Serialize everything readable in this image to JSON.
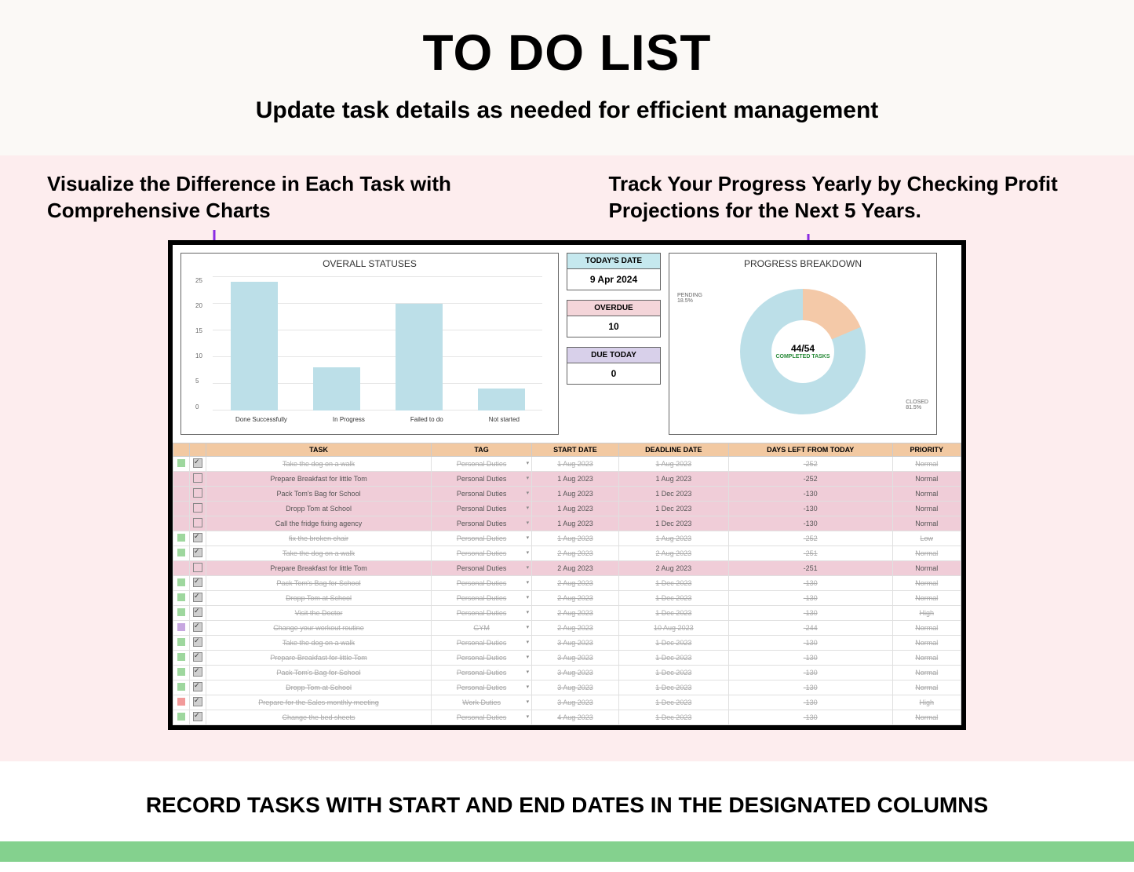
{
  "header": {
    "title": "TO DO LIST",
    "subtitle": "Update task details as needed for efficient management"
  },
  "callouts": {
    "left": "Visualize the Difference in Each Task with Comprehensive Charts",
    "right": "Track Your Progress Yearly by Checking Profit Projections for the Next 5 Years."
  },
  "stats": {
    "date_label": "TODAY'S DATE",
    "date_value": "9 Apr 2024",
    "overdue_label": "OVERDUE",
    "overdue_value": "10",
    "due_label": "DUE TODAY",
    "due_value": "0"
  },
  "chart_data": {
    "bar": {
      "type": "bar",
      "title": "OVERALL STATUSES",
      "categories": [
        "Done Successfully",
        "In Progress",
        "Failed to do",
        "Not started"
      ],
      "values": [
        24,
        8,
        20,
        4
      ],
      "ylim": [
        0,
        25
      ],
      "yticks": [
        0,
        5,
        10,
        15,
        20,
        25
      ]
    },
    "donut": {
      "type": "pie",
      "title": "PROGRESS BREAKDOWN",
      "series": [
        {
          "name": "PENDING",
          "value": 18.5
        },
        {
          "name": "CLOSED",
          "value": 81.5
        }
      ],
      "center_value": "44/54",
      "center_label": "COMPLETED TASKS"
    }
  },
  "columns": [
    "TASK",
    "TAG",
    "START DATE",
    "DEADLINE DATE",
    "DAYS LEFT FROM TODAY",
    "PRIORITY"
  ],
  "rows": [
    {
      "color": "#9ed79e",
      "chk": true,
      "done": true,
      "task": "Take the dog on a walk",
      "tag": "Personal Duties",
      "start": "1 Aug 2023",
      "deadline": "1 Aug 2023",
      "days": "-252",
      "priority": "Normal",
      "hl": false
    },
    {
      "color": "",
      "chk": false,
      "done": false,
      "task": "Prepare Breakfast for little Tom",
      "tag": "Personal Duties",
      "start": "1 Aug 2023",
      "deadline": "1 Aug 2023",
      "days": "-252",
      "priority": "Normal",
      "hl": true
    },
    {
      "color": "",
      "chk": false,
      "done": false,
      "task": "Pack Tom's Bag for School",
      "tag": "Personal Duties",
      "start": "1 Aug 2023",
      "deadline": "1 Dec 2023",
      "days": "-130",
      "priority": "Normal",
      "hl": true
    },
    {
      "color": "",
      "chk": false,
      "done": false,
      "task": "Dropp Tom at School",
      "tag": "Personal Duties",
      "start": "1 Aug 2023",
      "deadline": "1 Dec 2023",
      "days": "-130",
      "priority": "Normal",
      "hl": true
    },
    {
      "color": "",
      "chk": false,
      "done": false,
      "task": "Call the fridge fixing agency",
      "tag": "Personal Duties",
      "start": "1 Aug 2023",
      "deadline": "1 Dec 2023",
      "days": "-130",
      "priority": "Normal",
      "hl": true
    },
    {
      "color": "#9ed79e",
      "chk": true,
      "done": true,
      "task": "fix the broken chair",
      "tag": "Personal Duties",
      "start": "1 Aug 2023",
      "deadline": "1 Aug 2023",
      "days": "-252",
      "priority": "Low",
      "hl": false
    },
    {
      "color": "#9ed79e",
      "chk": true,
      "done": true,
      "task": "Take the dog on a walk",
      "tag": "Personal Duties",
      "start": "2 Aug 2023",
      "deadline": "2 Aug 2023",
      "days": "-251",
      "priority": "Normal",
      "hl": false
    },
    {
      "color": "",
      "chk": false,
      "done": false,
      "task": "Prepare Breakfast for little Tom",
      "tag": "Personal Duties",
      "start": "2 Aug 2023",
      "deadline": "2 Aug 2023",
      "days": "-251",
      "priority": "Normal",
      "hl": true
    },
    {
      "color": "#9ed79e",
      "chk": true,
      "done": true,
      "task": "Pack Tom's Bag for School",
      "tag": "Personal Duties",
      "start": "2 Aug 2023",
      "deadline": "1 Dec 2023",
      "days": "-130",
      "priority": "Normal",
      "hl": false
    },
    {
      "color": "#9ed79e",
      "chk": true,
      "done": true,
      "task": "Dropp Tom at School",
      "tag": "Personal Duties",
      "start": "2 Aug 2023",
      "deadline": "1 Dec 2023",
      "days": "-130",
      "priority": "Normal",
      "hl": false
    },
    {
      "color": "#9ed79e",
      "chk": true,
      "done": true,
      "task": "Visit the Doctor",
      "tag": "Personal Duties",
      "start": "2 Aug 2023",
      "deadline": "1 Dec 2023",
      "days": "-130",
      "priority": "High",
      "hl": false
    },
    {
      "color": "#c7a7e0",
      "chk": true,
      "done": true,
      "task": "Change your workout routine",
      "tag": "GYM",
      "start": "2 Aug 2023",
      "deadline": "10 Aug 2023",
      "days": "-244",
      "priority": "Normal",
      "hl": false
    },
    {
      "color": "#9ed79e",
      "chk": true,
      "done": true,
      "task": "Take the dog on a walk",
      "tag": "Personal Duties",
      "start": "3 Aug 2023",
      "deadline": "1 Dec 2023",
      "days": "-130",
      "priority": "Normal",
      "hl": false
    },
    {
      "color": "#9ed79e",
      "chk": true,
      "done": true,
      "task": "Prepare Breakfast for little Tom",
      "tag": "Personal Duties",
      "start": "3 Aug 2023",
      "deadline": "1 Dec 2023",
      "days": "-130",
      "priority": "Normal",
      "hl": false
    },
    {
      "color": "#9ed79e",
      "chk": true,
      "done": true,
      "task": "Pack Tom's Bag for School",
      "tag": "Personal Duties",
      "start": "3 Aug 2023",
      "deadline": "1 Dec 2023",
      "days": "-130",
      "priority": "Normal",
      "hl": false
    },
    {
      "color": "#9ed79e",
      "chk": true,
      "done": true,
      "task": "Dropp Tom at School",
      "tag": "Personal Duties",
      "start": "3 Aug 2023",
      "deadline": "1 Dec 2023",
      "days": "-130",
      "priority": "Normal",
      "hl": false
    },
    {
      "color": "#f29a9a",
      "chk": true,
      "done": true,
      "task": "Prepare for the Sales monthly meeting",
      "tag": "Work Duties",
      "start": "3 Aug 2023",
      "deadline": "1 Dec 2023",
      "days": "-130",
      "priority": "High",
      "hl": false
    },
    {
      "color": "#9ed79e",
      "chk": true,
      "done": true,
      "task": "Change the bed sheets",
      "tag": "Personal Duties",
      "start": "4 Aug 2023",
      "deadline": "1 Dec 2023",
      "days": "-130",
      "priority": "Normal",
      "hl": false
    }
  ],
  "footer": "RECORD TASKS WITH START AND END DATES IN THE DESIGNATED COLUMNS"
}
